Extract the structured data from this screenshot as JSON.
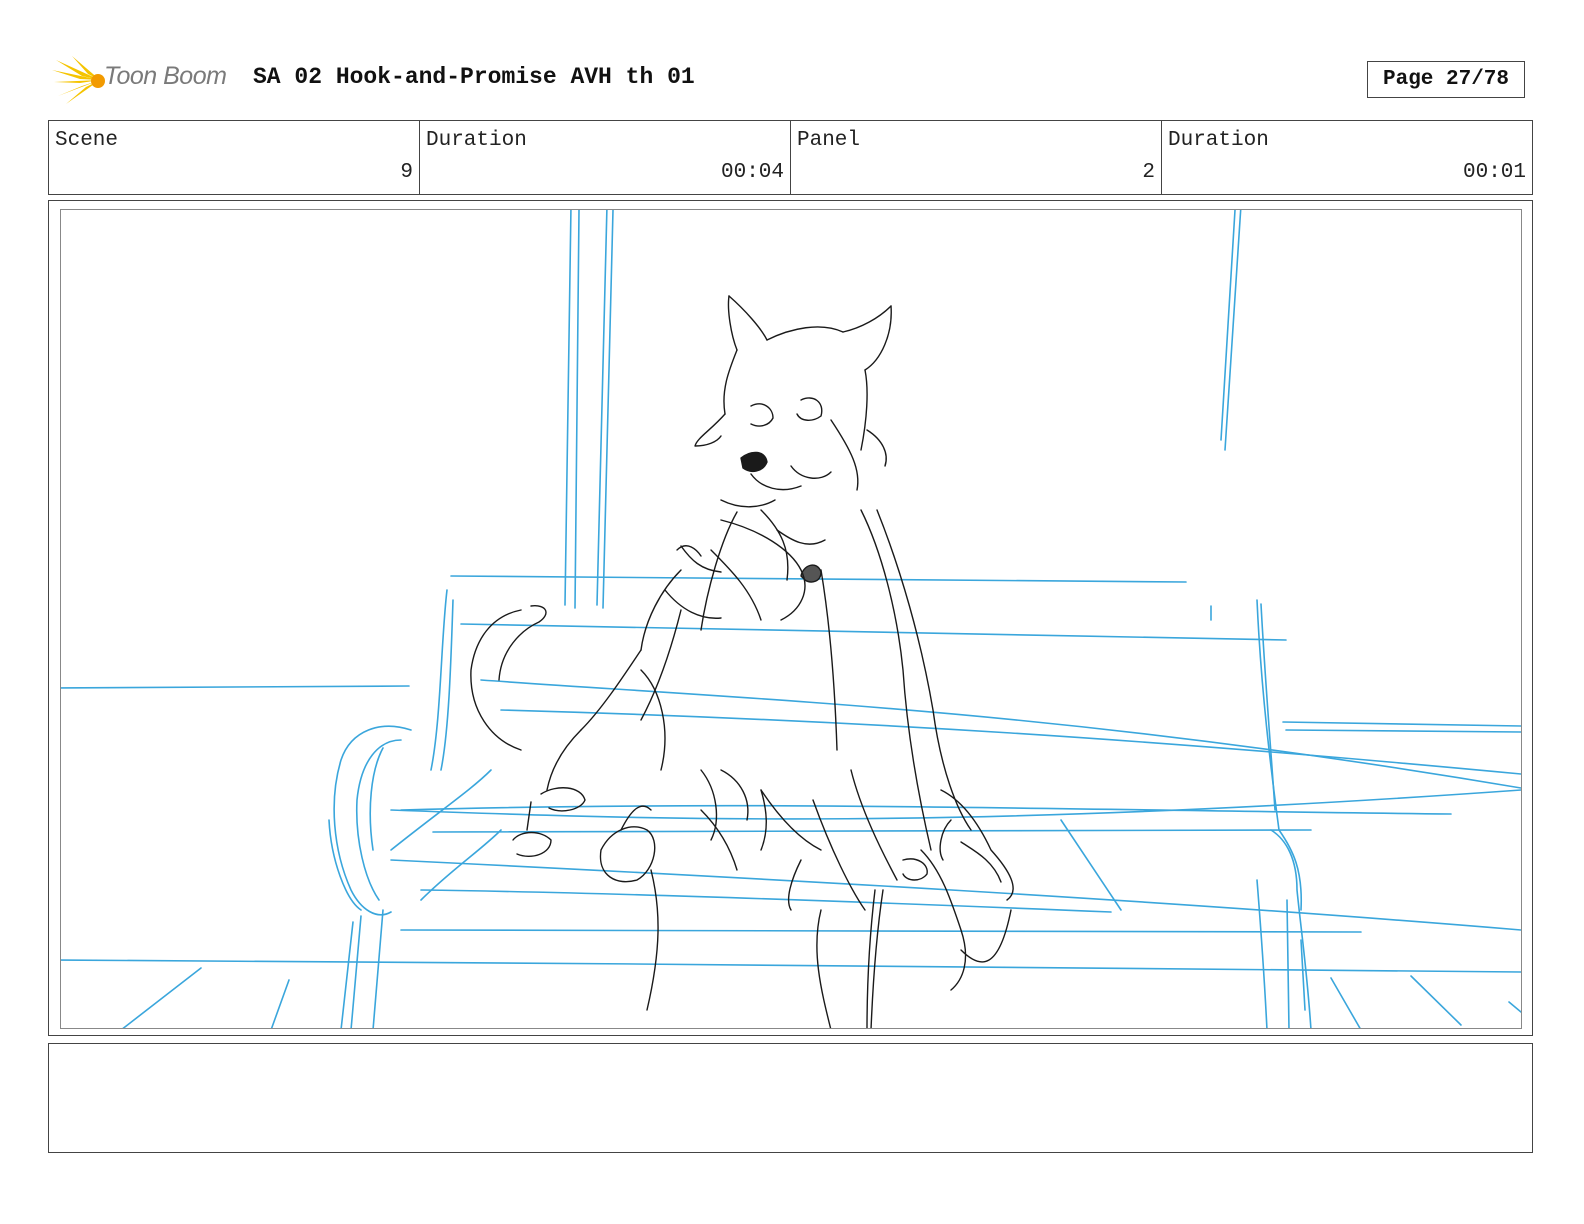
{
  "header": {
    "logo_text": "Toon Boom",
    "title": "SA 02 Hook-and-Promise AVH th 01",
    "page": "Page 27/78"
  },
  "info": [
    {
      "label": "Scene",
      "value": "9"
    },
    {
      "label": "Duration",
      "value": "00:04"
    },
    {
      "label": "Panel",
      "value": "2"
    },
    {
      "label": "Duration",
      "value": "00:01"
    }
  ],
  "panel": {
    "image": "storyboard-sketch-wolf-and-cat-on-couch",
    "colors": {
      "background_lines": "#3aa6dc",
      "character_lines": "#1a1a1a"
    }
  },
  "notes": {
    "text": ""
  },
  "colors": {
    "logo_yellow": "#f5c400",
    "logo_orange": "#f29a00",
    "border": "#444444"
  }
}
